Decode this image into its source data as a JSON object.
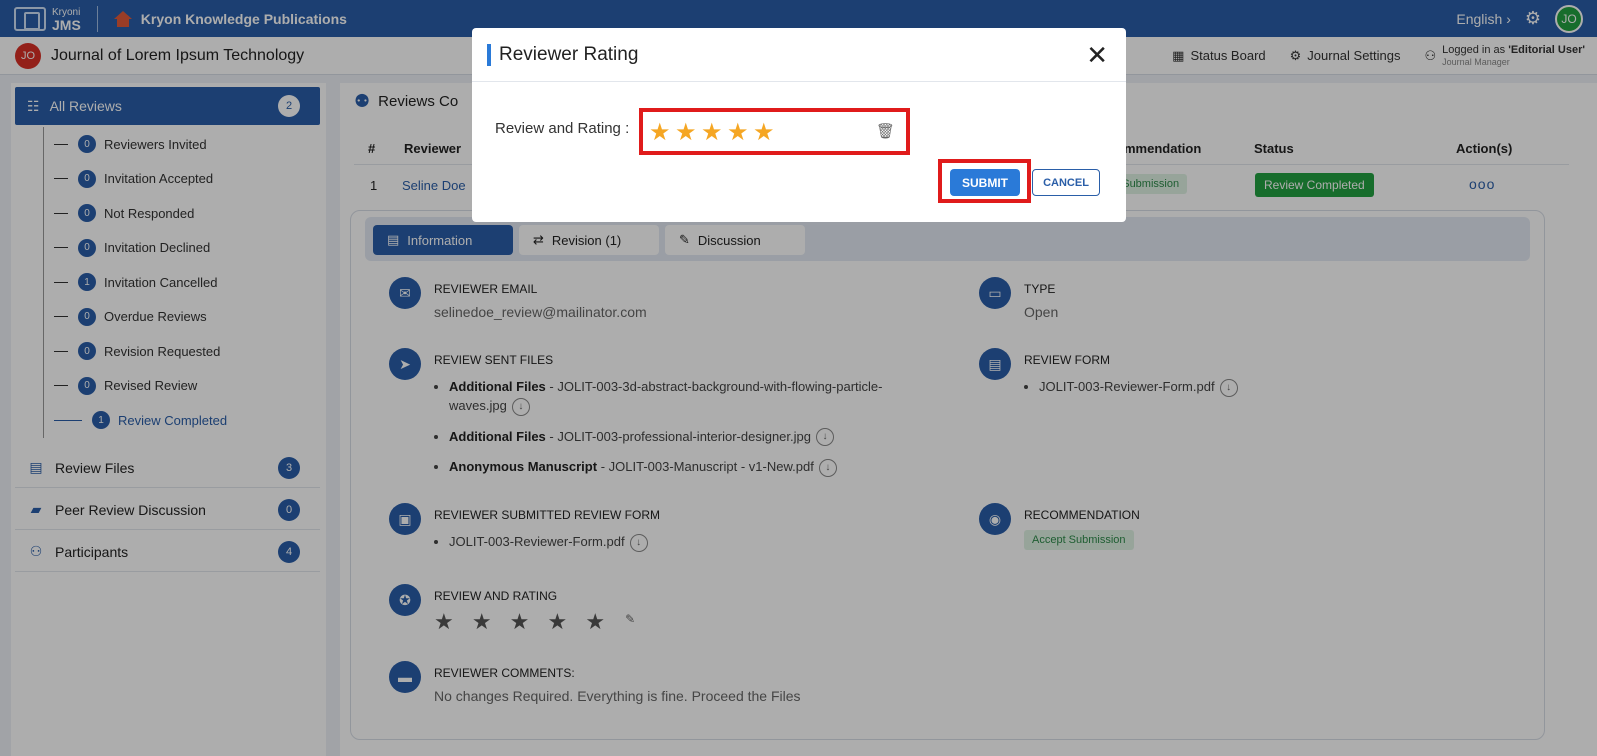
{
  "topbar": {
    "logo_small": "Kryoni",
    "logo_big": "JMS",
    "publisher": "Kryon Knowledge Publications",
    "language": "English",
    "user_initials": "JO"
  },
  "subbar": {
    "journal_initials": "JO",
    "journal_title": "Journal of Lorem Ipsum Technology",
    "status_board": "Status Board",
    "journal_settings": "Journal Settings",
    "logged_in_prefix": "Logged in as",
    "logged_in_user": "'Editorial User'",
    "role": "Journal Manager"
  },
  "sidebar": {
    "all_reviews": {
      "label": "All Reviews",
      "count": "2"
    },
    "items": [
      {
        "label": "Reviewers Invited",
        "count": "0"
      },
      {
        "label": "Invitation Accepted",
        "count": "0"
      },
      {
        "label": "Not Responded",
        "count": "0"
      },
      {
        "label": "Invitation Declined",
        "count": "0"
      },
      {
        "label": "Invitation Cancelled",
        "count": "1"
      },
      {
        "label": "Overdue Reviews",
        "count": "0"
      },
      {
        "label": "Revision Requested",
        "count": "0"
      },
      {
        "label": "Revised Review",
        "count": "0"
      },
      {
        "label": "Review Completed",
        "count": "1"
      }
    ],
    "sections": [
      {
        "label": "Review Files",
        "count": "3"
      },
      {
        "label": "Peer Review Discussion",
        "count": "0"
      },
      {
        "label": "Participants",
        "count": "4"
      }
    ]
  },
  "main": {
    "header": "Reviews Co",
    "columns": {
      "num": "#",
      "reviewer": "Reviewer",
      "recommendation": "mmendation",
      "status": "Status",
      "actions": "Action(s)"
    },
    "row": {
      "num": "1",
      "reviewer": "Seline Doe",
      "recommendation": "pt Submission",
      "status": "Review Completed",
      "actions": "ooo"
    },
    "tabs": {
      "information": "Information",
      "revision": "Revision (1)",
      "discussion": "Discussion"
    },
    "reviewer_email": {
      "label": "REVIEWER EMAIL",
      "value": "selinedoe_review@mailinator.com"
    },
    "type": {
      "label": "TYPE",
      "value": "Open"
    },
    "review_sent_files": {
      "label": "REVIEW SENT FILES",
      "files": [
        {
          "kind": "Additional Files",
          "name": "JOLIT-003-3d-abstract-background-with-flowing-particle-waves.jpg"
        },
        {
          "kind": "Additional Files",
          "name": "JOLIT-003-professional-interior-designer.jpg"
        },
        {
          "kind": "Anonymous Manuscript",
          "name": "JOLIT-003-Manuscript - v1-New.pdf"
        }
      ]
    },
    "review_form": {
      "label": "REVIEW FORM",
      "file": "JOLIT-003-Reviewer-Form.pdf"
    },
    "submitted_form": {
      "label": "REVIEWER SUBMITTED REVIEW FORM",
      "file": "JOLIT-003-Reviewer-Form.pdf"
    },
    "recommendation": {
      "label": "RECOMMENDATION",
      "value": "Accept Submission"
    },
    "review_rating": {
      "label": "REVIEW AND RATING",
      "stars": "★ ★ ★ ★ ★"
    },
    "comments": {
      "label": "REVIEWER COMMENTS:",
      "value": "No changes Required. Everything is fine. Proceed the Files"
    }
  },
  "modal": {
    "title": "Reviewer Rating",
    "close": "✕",
    "rating_label": "Review and Rating :",
    "rating_value": 5,
    "rating_max": 5,
    "submit": "SUBMIT",
    "cancel": "CANCEL"
  },
  "colors": {
    "primary": "#2a5ea8",
    "star": "#f5a623",
    "highlight": "#e01b1b",
    "success": "#23a141"
  }
}
